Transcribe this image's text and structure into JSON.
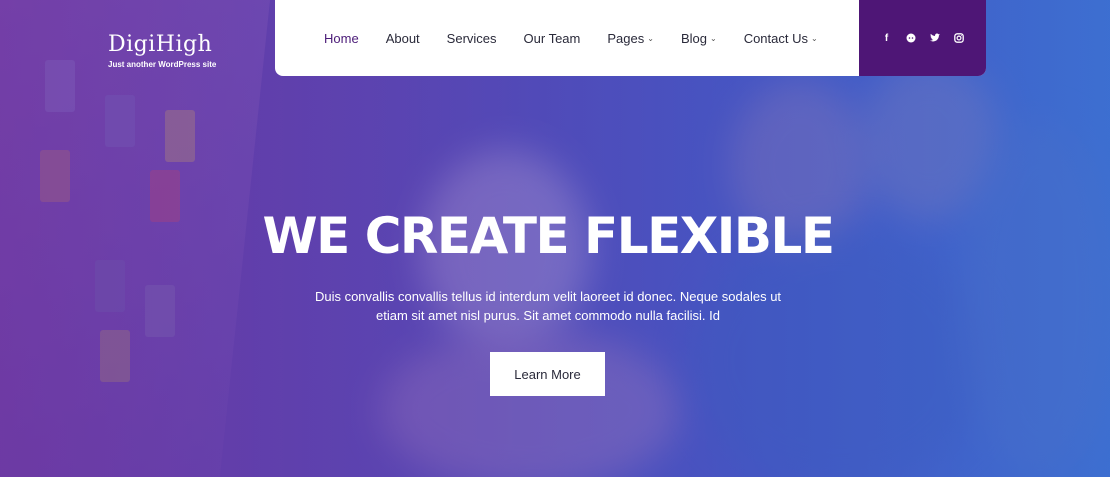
{
  "brand": {
    "name": "DigiHigh",
    "tagline": "Just another WordPress site"
  },
  "nav": {
    "items": [
      {
        "label": "Home",
        "active": true,
        "dropdown": false
      },
      {
        "label": "About",
        "active": false,
        "dropdown": false
      },
      {
        "label": "Services",
        "active": false,
        "dropdown": false
      },
      {
        "label": "Our Team",
        "active": false,
        "dropdown": false
      },
      {
        "label": "Pages",
        "active": false,
        "dropdown": true
      },
      {
        "label": "Blog",
        "active": false,
        "dropdown": true
      },
      {
        "label": "Contact Us",
        "active": false,
        "dropdown": true
      }
    ],
    "dropdown_icon": "chevron-down-icon"
  },
  "social": {
    "icons": [
      "facebook-icon",
      "reddit-icon",
      "twitter-icon",
      "instagram-icon"
    ],
    "background": "#4e1676"
  },
  "hero": {
    "headline": "WE CREATE FLEXIBLE",
    "subtext": "Duis convallis convallis tellus id interdum velit laoreet id donec. Neque sodales ut etiam sit amet nisl purus. Sit amet commodo nulla facilisi. Id",
    "cta_label": "Learn More"
  },
  "colors": {
    "accent": "#4e1676",
    "nav_active": "#4b1b78",
    "overlay_left": "#6a3aa4",
    "overlay_right": "#3d6fd0"
  }
}
